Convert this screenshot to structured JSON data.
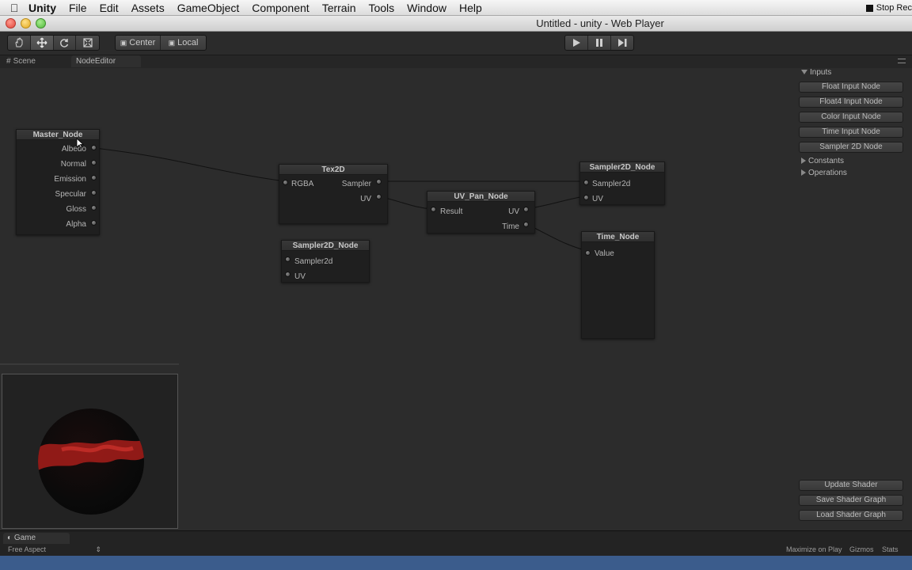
{
  "menubar": {
    "app": "Unity",
    "items": [
      "File",
      "Edit",
      "Assets",
      "GameObject",
      "Component",
      "Terrain",
      "Tools",
      "Window",
      "Help"
    ],
    "right_label": "Stop Rec"
  },
  "window": {
    "title": "Untitled - unity - Web Player"
  },
  "toolbar": {
    "pivot_center": "Center",
    "pivot_local": "Local",
    "tools": [
      "hand-icon",
      "move-icon",
      "rotate-icon",
      "scale-icon"
    ],
    "play": [
      "play-icon",
      "pause-icon",
      "step-icon"
    ]
  },
  "tabs": {
    "scene": "Scene",
    "node_editor": "NodeEditor"
  },
  "nodes": {
    "master": {
      "title": "Master_Node",
      "ports": [
        "Albedo",
        "Normal",
        "Emission",
        "Specular",
        "Gloss",
        "Alpha"
      ]
    },
    "tex2d": {
      "title": "Tex2D",
      "in": "RGBA",
      "out": [
        "Sampler",
        "UV"
      ]
    },
    "sampler_a": {
      "title": "Sampler2D_Node",
      "ports": [
        "Sampler2d",
        "UV"
      ]
    },
    "uvpan": {
      "title": "UV_Pan_Node",
      "in": "Result",
      "out": [
        "UV",
        "Time"
      ]
    },
    "sampler_b": {
      "title": "Sampler2D_Node",
      "ports": [
        "Sampler2d",
        "UV"
      ]
    },
    "time": {
      "title": "Time_Node",
      "ports": [
        "Value"
      ]
    }
  },
  "sidebar": {
    "inputs_label": "Inputs",
    "input_buttons": [
      "Float Input Node",
      "Float4 Input Node",
      "Color Input Node",
      "Time Input Node",
      "Sampler 2D Node"
    ],
    "constants_label": "Constants",
    "operations_label": "Operations",
    "actions": [
      "Update Shader",
      "Save Shader Graph",
      "Load Shader Graph"
    ]
  },
  "game": {
    "tab": "Game",
    "aspect": "Free Aspect",
    "maximize": "Maximize on Play",
    "gizmos": "Gizmos",
    "stats": "Stats"
  },
  "colors": {
    "blue_strip": "#3b5c8c",
    "preview_red": "#b1221c"
  }
}
